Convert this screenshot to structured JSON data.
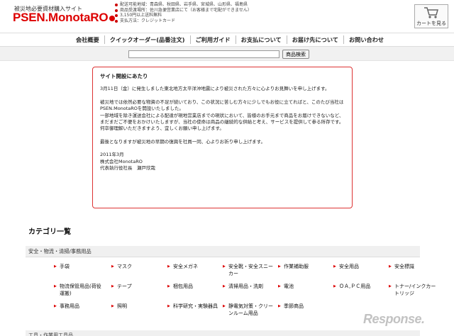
{
  "header": {
    "tagline": "被災地必要資材購入サイト",
    "logo_text": "PSEN.MonotaRO",
    "notes": [
      "配送可能地域：青森県、秋田県、岩手県、宮城県、山形県、福島県",
      "商品受渡場所：佐川急便営業店にて（お客様まで宅配ができません）",
      "3,150円以上送料無料",
      "支払方法：クレジットカード"
    ],
    "cart_label": "カートを見る"
  },
  "nav": {
    "items": [
      "会社概要",
      "クイックオーダー(品番注文)",
      "ご利用ガイド",
      "お支払について",
      "お届け先について",
      "お問い合わせ"
    ]
  },
  "search": {
    "value": "",
    "button_label": "商品検索"
  },
  "notice": {
    "title": "サイト開設にあたり",
    "p1": "3月11日（金）に発生しました東北地方太平洋沖地震により被災された方々に心よりお見舞いを申し上げます。",
    "p2a": "被災地では依然必要な物資の不足が続いており、この状況に苦しむ方々に少しでもお役に立てればと、このたび当社はPSEN.MonotaROを開設いたしました。",
    "p2b": "一部地域を除き運送会社による配達が現地営業店までの現状において、皆様のお手元まで商品をお届けできないなど、まだまだご不便をおかけいたしますが、当社の使命は商品の継続的な供給と考え、サービスを提供して参る所存です。",
    "p2c": "何卒御理解いただきますよう、宜しくお願い申し上げます。",
    "p3": "最後となりますが被災地の早期の復興を社員一同、心よりお祈り申し上げます。",
    "date": "2011年3月",
    "company": "株式会社MonotaRO",
    "signer": "代表執行役社長　瀬戸欣哉"
  },
  "categories": {
    "title": "カテゴリ一覧",
    "section1": "安全・物流・清掃/事務用品",
    "row1": [
      "手袋",
      "マスク",
      "安全メガネ",
      "安全靴・安全スニー",
      "作業補助服",
      "安全用品",
      "安全標識"
    ],
    "row1_extra": "カー",
    "row2": [
      "物流保管用品(荷役",
      "テープ",
      "梱包用品",
      "清掃用品・洗剤",
      "電池",
      "ＯＡ,ＰＣ用品",
      "トナー/インクカー"
    ],
    "row2_extra": [
      "運搬)",
      "トリッジ"
    ],
    "row3": [
      "事務用品",
      "照明",
      "科学研究・実験器具",
      "静電気対策・クリー",
      "季節商品"
    ],
    "row3_extra": "ンルーム用品",
    "section2": "工具・作業用工具品"
  },
  "watermark": "Response."
}
